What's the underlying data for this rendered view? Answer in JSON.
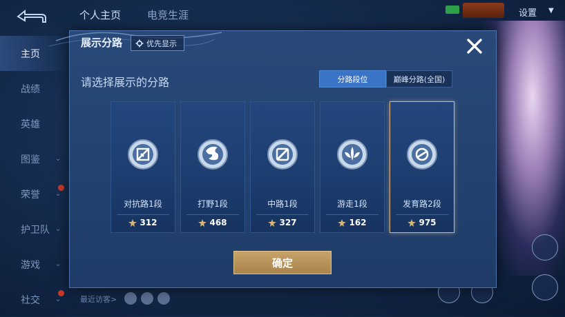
{
  "background": {
    "tabs": [
      {
        "label": "个人主页",
        "active": true
      },
      {
        "label": "电竞生涯",
        "active": false
      }
    ],
    "sidebar": [
      {
        "label": "主页",
        "active": true,
        "chevron": false,
        "dot": false
      },
      {
        "label": "战绩",
        "active": false,
        "chevron": false,
        "dot": false
      },
      {
        "label": "英雄",
        "active": false,
        "chevron": false,
        "dot": false
      },
      {
        "label": "图鉴",
        "active": false,
        "chevron": true,
        "dot": false
      },
      {
        "label": "荣誉",
        "active": false,
        "chevron": true,
        "dot": true
      },
      {
        "label": "护卫队",
        "active": false,
        "chevron": true,
        "dot": false
      },
      {
        "label": "游戏",
        "active": false,
        "chevron": true,
        "dot": false
      },
      {
        "label": "社交",
        "active": false,
        "chevron": true,
        "dot": true
      }
    ],
    "settings_label": "设置",
    "recent_visitors_label": "最近访客>"
  },
  "modal": {
    "title": "展示分路",
    "priority_button_label": "优先显示",
    "subtitle": "请选择展示的分路",
    "segments": [
      {
        "label": "分路段位",
        "active": true
      },
      {
        "label": "巅峰分路(全国)",
        "active": false
      }
    ],
    "lanes": [
      {
        "label": "对抗路1段",
        "score": "312",
        "icon": "clash-lane-icon",
        "selected": false
      },
      {
        "label": "打野1段",
        "score": "468",
        "icon": "jungle-icon",
        "selected": false
      },
      {
        "label": "中路1段",
        "score": "327",
        "icon": "mid-lane-icon",
        "selected": false
      },
      {
        "label": "游走1段",
        "score": "162",
        "icon": "roam-icon",
        "selected": false
      },
      {
        "label": "发育路2段",
        "score": "975",
        "icon": "farm-lane-icon",
        "selected": true
      }
    ],
    "confirm_label": "确定"
  },
  "colors": {
    "accent_blue": "#3a74c6",
    "gold": "#c9a46a",
    "selected_border": "#d9b58a"
  }
}
